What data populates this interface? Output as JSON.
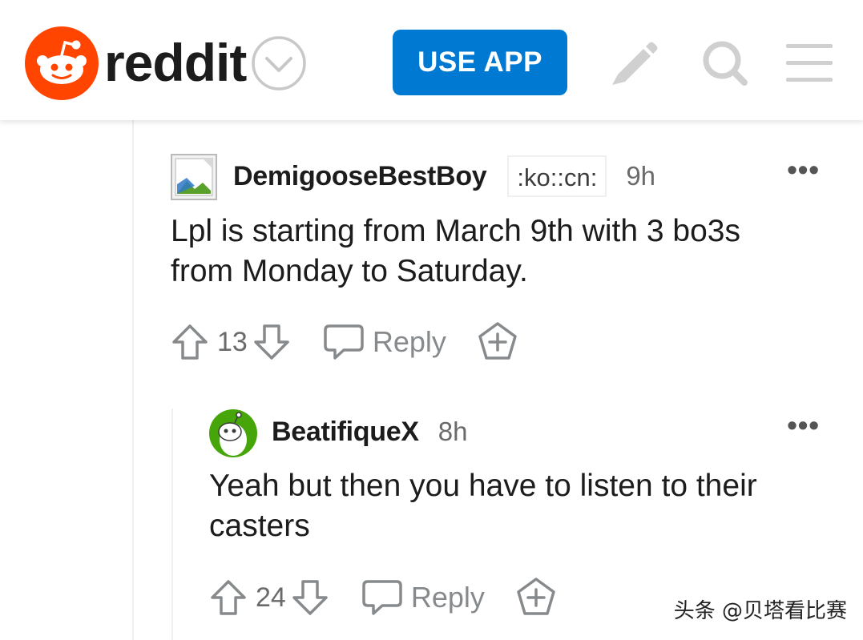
{
  "header": {
    "logo_text": "reddit",
    "use_app_label": "USE APP",
    "brand_color": "#ff4500",
    "button_color": "#0079d3",
    "icons": [
      "reddit-logo-icon",
      "chevron-down-icon",
      "pencil-icon",
      "search-icon",
      "menu-icon"
    ]
  },
  "comments": [
    {
      "username": "DemigooseBestBoy",
      "flair": ":ko::cn:",
      "time": "9h",
      "body_lines": [
        "Lpl is starting from March 9th with 3 bo3s",
        "from Monday to Saturday."
      ],
      "score": "13",
      "reply_label": "Reply",
      "more_label": "•••"
    },
    {
      "username": "BeatifiqueX",
      "time": "8h",
      "body_lines": [
        "Yeah but then you have to listen to their",
        "casters"
      ],
      "score": "24",
      "reply_label": "Reply",
      "more_label": "•••",
      "avatar_color": "#46a508"
    }
  ],
  "watermark": "头条 @贝塔看比赛"
}
